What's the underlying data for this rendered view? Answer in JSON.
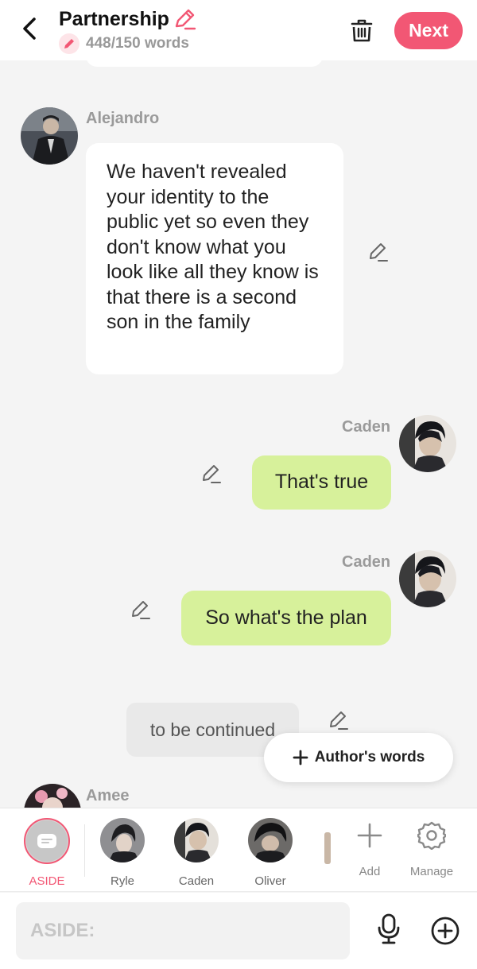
{
  "header": {
    "title": "Partnership",
    "word_count": "448/150 words",
    "next_label": "Next"
  },
  "messages": [
    {
      "speaker": "Alejandro",
      "text": "We haven't revealed your identity to the public yet so even they don't know what you look like all they know is that there is a second son in the family"
    },
    {
      "speaker": "Caden",
      "text": "That's true"
    },
    {
      "speaker": "Caden",
      "text": "So what's the plan"
    },
    {
      "narration": "to be continued"
    },
    {
      "speaker": "Amee"
    }
  ],
  "authors_words_label": "Author's words",
  "characters": {
    "aside": "ASIDE",
    "c1": "Ryle",
    "c2": "Caden",
    "c3": "Oliver"
  },
  "tools": {
    "add": "Add",
    "manage": "Manage"
  },
  "input": {
    "placeholder": "ASIDE:"
  },
  "colors": {
    "accent": "#f25774",
    "green_bubble": "#d7f19b",
    "background": "#f4f4f4"
  },
  "icons": [
    "back-arrow-icon",
    "pencil-icon",
    "trash-icon",
    "edit-icon",
    "plus-icon",
    "gear-icon",
    "mic-icon",
    "plus-circle-icon",
    "aside-chat-icon"
  ]
}
